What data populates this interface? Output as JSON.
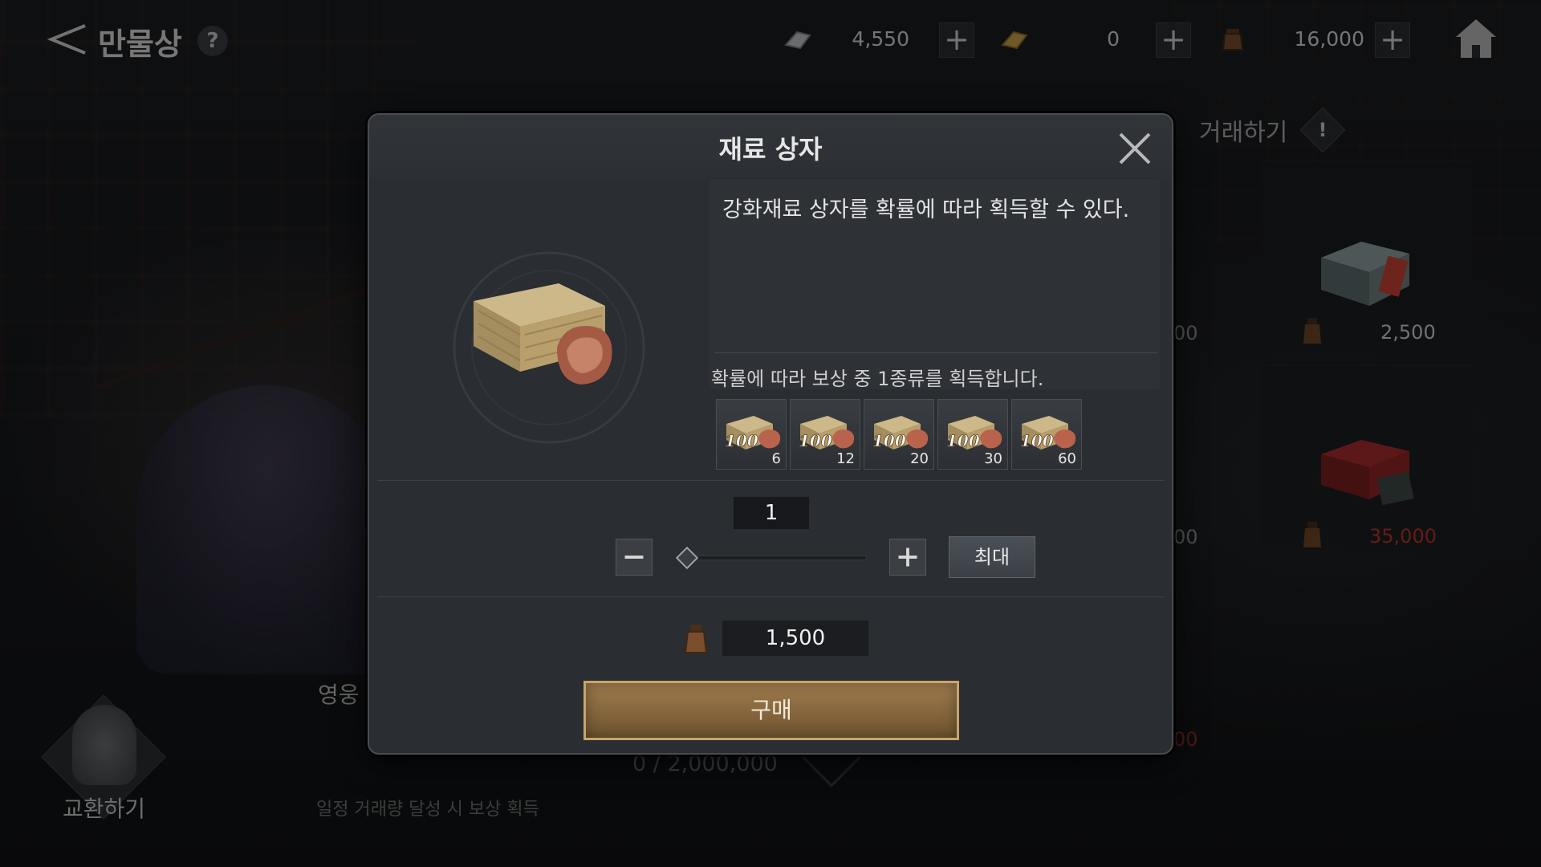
{
  "topbar": {
    "title": "만물상",
    "help_glyph": "?",
    "currencies": [
      {
        "icon": "silver-ingot-icon",
        "value": "4,550"
      },
      {
        "icon": "gold-ingot-icon",
        "value": "0"
      },
      {
        "icon": "coin-pouch-icon",
        "value": "16,000"
      }
    ],
    "plus_glyph": "+"
  },
  "shop": {
    "trade_tab": "거래하기",
    "trade_alert": "!",
    "items": [
      {
        "icon": "stone-chest-icon",
        "price": "2,500",
        "price_color": "#cfcfcf"
      },
      {
        "icon": "red-treasure-chest-icon",
        "price": "35,000",
        "price_color": "#b8332b"
      }
    ],
    "edge_fragments": [
      "00",
      "00",
      "00"
    ]
  },
  "footer": {
    "exchange_label": "교환하기",
    "hero_label": "영웅",
    "progress": "0 / 2,000,000",
    "reward_hint": "일정 거래량 달성 시 보상 획득"
  },
  "dialog": {
    "title": "재료 상자",
    "item_icon": "material-bundle-icon",
    "description": "강화재료 상자를 확률에 따라 획득할 수 있다.",
    "reward_caption": "확률에 따라 보상 중 1종류를 획득합니다.",
    "rewards": [
      {
        "icon": "material-pack-icon",
        "label": "100",
        "qty": "6"
      },
      {
        "icon": "material-pack-icon",
        "label": "100",
        "qty": "12"
      },
      {
        "icon": "material-pack-icon",
        "label": "100",
        "qty": "20"
      },
      {
        "icon": "material-pack-icon",
        "label": "100",
        "qty": "30"
      },
      {
        "icon": "material-pack-icon",
        "label": "100",
        "qty": "60"
      }
    ],
    "quantity": "1",
    "slider_fraction": 0.0,
    "max_label": "최대",
    "price": "1,500",
    "buy_label": "구매",
    "accent_color": "#a07c4e"
  }
}
